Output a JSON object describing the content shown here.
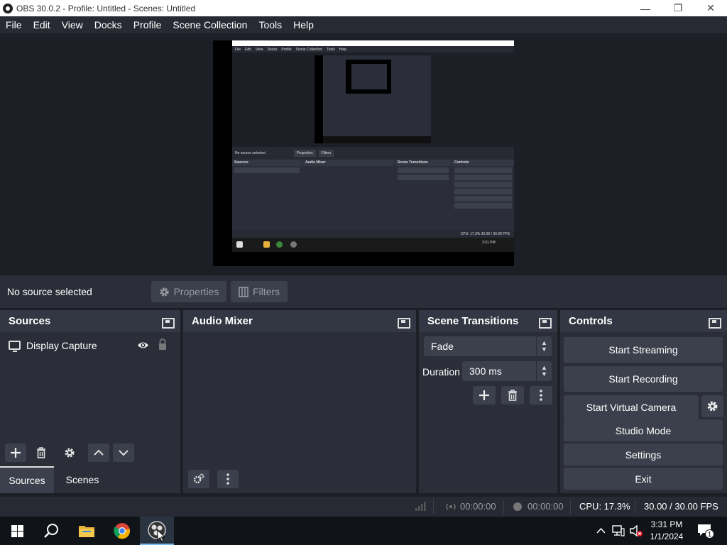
{
  "window": {
    "title": "OBS 30.0.2 - Profile: Untitled - Scenes: Untitled",
    "minimize": "—",
    "maximize": "❐",
    "close": "✕"
  },
  "menu": [
    "File",
    "Edit",
    "View",
    "Docks",
    "Profile",
    "Scene Collection",
    "Tools",
    "Help"
  ],
  "preview": {
    "mini_menu": [
      "File",
      "Edit",
      "View",
      "Docks",
      "Profile",
      "Scene Collection",
      "Tools",
      "Help"
    ],
    "mini_context": "No source selected",
    "mini_properties": "Properties",
    "mini_filters": "Filters",
    "mini_sources": "Sources",
    "mini_audio": "Audio Mixer",
    "mini_transitions": "Scene Transitions",
    "mini_controls": "Controls",
    "mini_status": "CPU: 17.3%   30.00 / 30.00 FPS",
    "mini_clock": "3:31 PM"
  },
  "context": {
    "text": "No source selected",
    "properties_label": "Properties",
    "filters_label": "Filters"
  },
  "sources": {
    "title": "Sources",
    "items": [
      {
        "label": "Display Capture"
      }
    ],
    "tab_sources": "Sources",
    "tab_scenes": "Scenes"
  },
  "audio": {
    "title": "Audio Mixer"
  },
  "transitions": {
    "title": "Scene Transitions",
    "selected": "Fade",
    "duration_label": "Duration",
    "duration_value": "300 ms"
  },
  "controls": {
    "title": "Controls",
    "start_streaming": "Start Streaming",
    "start_recording": "Start Recording",
    "start_virtual_camera": "Start Virtual Camera",
    "studio_mode": "Studio Mode",
    "settings": "Settings",
    "exit": "Exit"
  },
  "status": {
    "stream_time": "00:00:00",
    "record_time": "00:00:00",
    "cpu": "CPU: 17.3%",
    "fps": "30.00 / 30.00 FPS"
  },
  "taskbar": {
    "time": "3:31 PM",
    "date": "1/1/2024",
    "notification_count": "1"
  },
  "colors": {
    "background": "#1d1f26",
    "dock": "#2b2e38",
    "button": "#3c404c",
    "taskbar": "#101418"
  }
}
